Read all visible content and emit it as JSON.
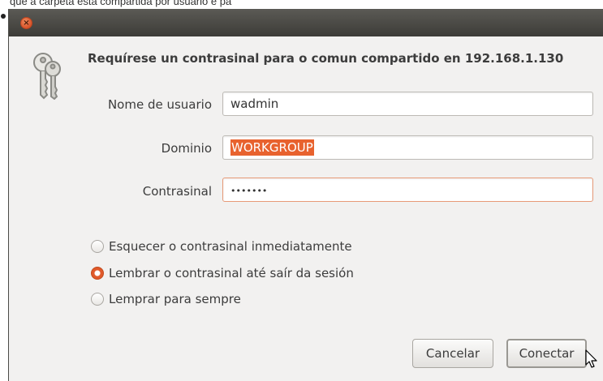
{
  "caption": "que a carpeta está compartida por usuario e pa",
  "dialog": {
    "title": "Requírese un contrasinal para o comun compartido en 192.168.1.130",
    "fields": {
      "username": {
        "label": "Nome de usuario",
        "value": "wadmin"
      },
      "domain": {
        "label": "Dominio",
        "value": "WORKGROUP"
      },
      "password": {
        "label": "Contrasinal",
        "value": "•••••••"
      }
    },
    "remember_options": [
      {
        "label": "Esquecer o contrasinal inmediatamente",
        "selected": false
      },
      {
        "label": "Lembrar o contrasinal até saír da sesión",
        "selected": true
      },
      {
        "label": "Lemprar para sempre",
        "selected": false
      }
    ],
    "buttons": {
      "cancel": "Cancelar",
      "connect": "Conectar"
    }
  },
  "icons": {
    "close": "close-icon",
    "keys": "keys-icon",
    "cursor": "mouse-pointer-icon"
  },
  "colors": {
    "accent": "#e8622e",
    "titlebar": "#3d3c38",
    "window_bg": "#f2f1f0"
  }
}
